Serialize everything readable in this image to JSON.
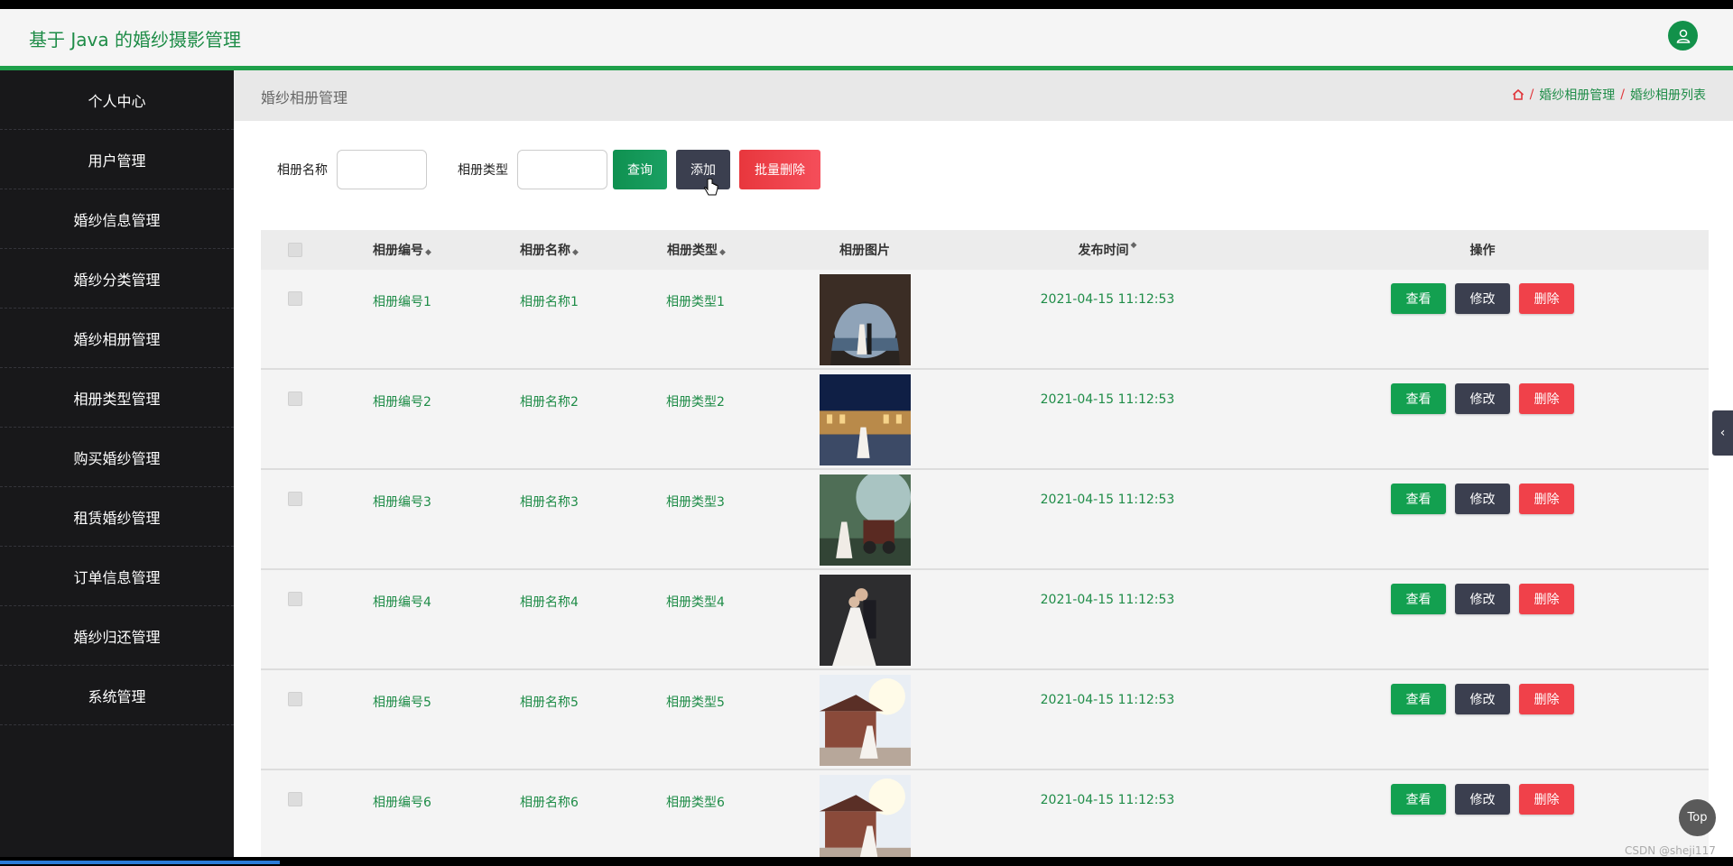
{
  "app": {
    "title": "基于 Java 的婚纱摄影管理"
  },
  "sidebar": {
    "items": [
      {
        "label": "个人中心"
      },
      {
        "label": "用户管理"
      },
      {
        "label": "婚纱信息管理"
      },
      {
        "label": "婚纱分类管理"
      },
      {
        "label": "婚纱相册管理"
      },
      {
        "label": "相册类型管理"
      },
      {
        "label": "购买婚纱管理"
      },
      {
        "label": "租赁婚纱管理"
      },
      {
        "label": "订单信息管理"
      },
      {
        "label": "婚纱归还管理"
      },
      {
        "label": "系统管理"
      }
    ]
  },
  "page": {
    "title": "婚纱相册管理",
    "breadcrumb": [
      "婚纱相册管理",
      "婚纱相册列表"
    ]
  },
  "search": {
    "name_label": "相册名称",
    "type_label": "相册类型",
    "name_value": "",
    "type_value": "",
    "query_label": "查询",
    "add_label": "添加",
    "batch_delete_label": "批量删除"
  },
  "table": {
    "headers": {
      "no": "相册编号",
      "name": "相册名称",
      "type": "相册类型",
      "image": "相册图片",
      "time": "发布时间",
      "ops": "操作"
    },
    "rows": [
      {
        "no": "相册编号1",
        "name": "相册名称1",
        "type": "相册类型1",
        "time": "2021-04-15 11:12:53"
      },
      {
        "no": "相册编号2",
        "name": "相册名称2",
        "type": "相册类型2",
        "time": "2021-04-15 11:12:53"
      },
      {
        "no": "相册编号3",
        "name": "相册名称3",
        "type": "相册类型3",
        "time": "2021-04-15 11:12:53"
      },
      {
        "no": "相册编号4",
        "name": "相册名称4",
        "type": "相册类型4",
        "time": "2021-04-15 11:12:53"
      },
      {
        "no": "相册编号5",
        "name": "相册名称5",
        "type": "相册类型5",
        "time": "2021-04-15 11:12:53"
      },
      {
        "no": "相册编号6",
        "name": "相册名称6",
        "type": "相册类型6",
        "time": "2021-04-15 11:12:53"
      }
    ],
    "ops": {
      "view": "查看",
      "edit": "修改",
      "delete": "删除"
    }
  },
  "widgets": {
    "top_label": "Top",
    "watermark": "CSDN @sheji117"
  },
  "colors": {
    "accent": "#1ea04a",
    "sidebar_bg": "#18181a",
    "danger": "#f0414a",
    "dark_button": "#3b3f4f"
  },
  "icons": {
    "avatar": "user-icon",
    "home": "home-icon",
    "cursor": "hand-cursor-icon",
    "right_tab": "chevron-left-icon"
  }
}
